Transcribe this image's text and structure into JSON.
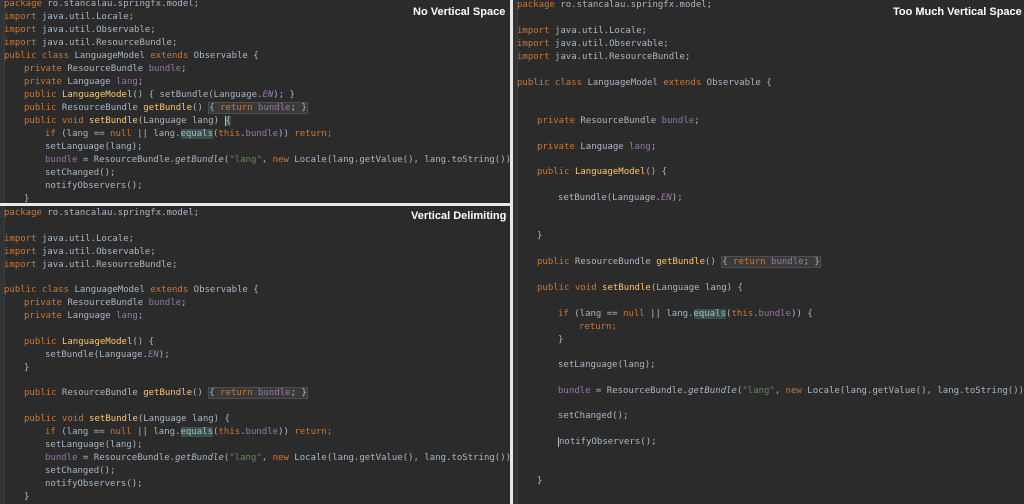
{
  "panes": {
    "top_left": {
      "title": "No Vertical Space"
    },
    "bottom_left": {
      "title": "Vertical Delimiting"
    },
    "right": {
      "title": "Too Much Vertical Space"
    }
  },
  "code": {
    "pkg_kw": "package",
    "pkg_name": " ro.stancalau.springfx.model;",
    "import_kw": "import",
    "imp_locale": " java.util.Locale;",
    "imp_observable": " java.util.Observable;",
    "imp_bundle": " java.util.ResourceBundle;",
    "pub_class": "public class",
    "class_name": " LanguageModel ",
    "extends_kw": "extends",
    "observable_sp": " Observable {",
    "private_kw": "private",
    "rb_sp": " ResourceBundle ",
    "bundle_field": "bundle",
    "semi": ";",
    "lang_type_sp": " Language ",
    "lang_field": "lang",
    "public_kw": "public",
    "ctor_name": "LanguageModel",
    "parens_open": "() {",
    "setbundle_call": "setBundle(Language.",
    "en_const": "EN",
    "call_end": ");",
    "close_brace_inline": " }",
    "rb_type_sp": " ResourceBundle ",
    "getbundle_name": "getBundle",
    "parens": "()",
    "fold_open": "{",
    "return_kw": "return",
    "bundle_semi": ";",
    "fold_close": "}",
    "void_kw": "void",
    "setbundle_name": "setBundle",
    "param": "(Language lang) ",
    "open_brace": "{",
    "if_kw": "if",
    "if_cond": " (lang == ",
    "null_kw": "null",
    "or_lang": " || lang.",
    "equals_name": "equals",
    "paren_open": "(",
    "this_kw": "this",
    "dot": ".",
    "close_paren2": "))",
    "return_stmt": " return;",
    "close_paren_brace": ")) {",
    "return_semi": "return;",
    "setlanguage": "setLanguage(lang);",
    "bundle_assign": "bundle = ResourceBundle.",
    "getbundle_static": "getBundle",
    "lang_str": "\"lang\"",
    "comma_sp": ", ",
    "new_kw": "new",
    "locale_expr": " Locale(lang.getValue(), lang.toString()));",
    "getbundle_paren": "(",
    "setchanged": "setChanged();",
    "notify": "notifyObservers();",
    "close_brace": "}",
    "space": " "
  }
}
